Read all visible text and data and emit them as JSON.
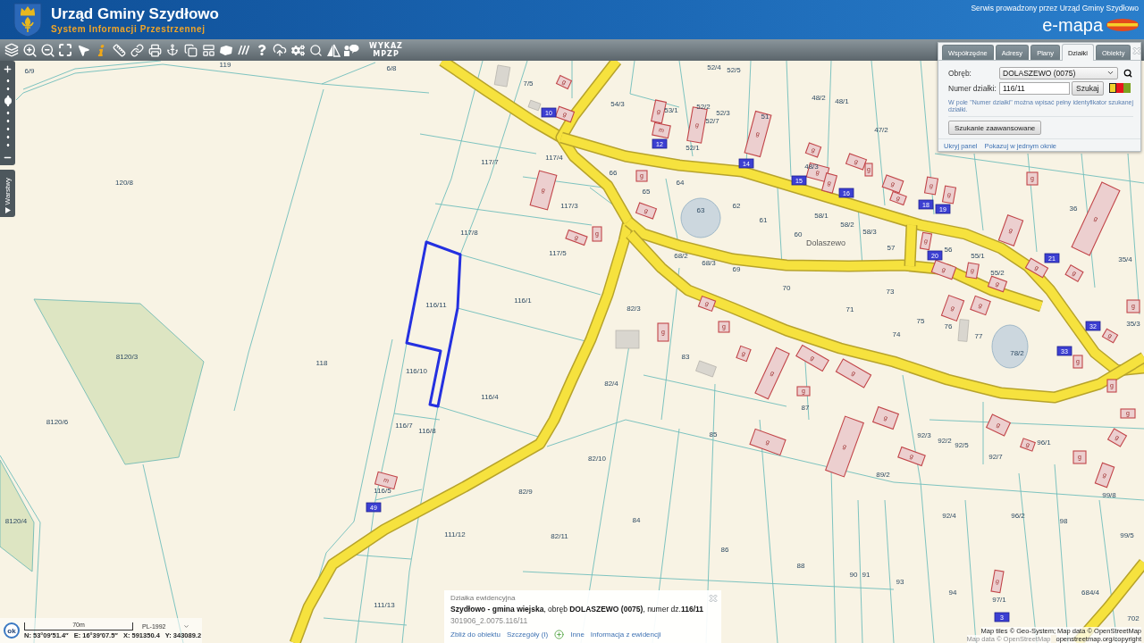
{
  "header": {
    "title": "Urząd Gminy Szydłowo",
    "subtitle": "System Informacji Przestrzennej",
    "service_note": "Serwis prowadzony przez Urząd Gminy Szydłowo",
    "brand": "e-mapa"
  },
  "toolbar": {
    "list_button": "WYKAZ MPZP"
  },
  "zoom_slider": {
    "level": 0.67
  },
  "layers_tab": {
    "label": "Warstwy"
  },
  "search_panel": {
    "tabs": [
      {
        "label": "Współrzędne",
        "selected": false
      },
      {
        "label": "Adresy",
        "selected": false
      },
      {
        "label": "Plany",
        "selected": false
      },
      {
        "label": "Działki",
        "selected": true
      },
      {
        "label": "Obiekty",
        "selected": false
      }
    ],
    "fields": [
      {
        "kind": "select",
        "label": "Obręb:",
        "value": "DOLASZEWO (0075)"
      },
      {
        "kind": "input",
        "label": "Numer działki:",
        "value": "116/11"
      }
    ],
    "search_button": "Szukaj",
    "colors": [
      {
        "color": "#f2d22a",
        "selected": true
      },
      {
        "color": "#e8141c",
        "selected": false
      },
      {
        "color": "#7ca21f",
        "selected": false
      }
    ],
    "hint": "W pole \"Numer działki\" można wpisać pełny identyfikator szukanej działki.",
    "advanced_button": "Szukanie zaawansowane",
    "links": [
      "Ukryj panel",
      "Pokazuj w jednym oknie"
    ]
  },
  "map": {
    "place_name": "Dolaszewo",
    "parcels": [
      {
        "number": "6/9",
        "selected": false
      },
      {
        "number": "119",
        "selected": false
      },
      {
        "number": "6/8",
        "selected": false
      },
      {
        "number": "120/8",
        "selected": false
      },
      {
        "number": "8120/3",
        "selected": false
      },
      {
        "number": "118",
        "selected": false
      },
      {
        "number": "8120/6",
        "selected": false
      },
      {
        "number": "8120/4",
        "selected": false
      },
      {
        "number": "117/7",
        "selected": false
      },
      {
        "number": "117/8",
        "selected": false
      },
      {
        "number": "117/4",
        "selected": false
      },
      {
        "number": "117/3",
        "selected": false
      },
      {
        "number": "117/5",
        "selected": false
      },
      {
        "number": "116/11",
        "selected": true
      },
      {
        "number": "116/1",
        "selected": false
      },
      {
        "number": "116/10",
        "selected": false
      },
      {
        "number": "116/4",
        "selected": false
      },
      {
        "number": "116/7",
        "selected": false
      },
      {
        "number": "116/8",
        "selected": false
      },
      {
        "number": "116/5",
        "selected": false
      },
      {
        "number": "111/12",
        "selected": false
      },
      {
        "number": "111/13",
        "selected": false
      },
      {
        "number": "7/5",
        "selected": false
      },
      {
        "number": "54/3",
        "selected": false
      },
      {
        "number": "53/1",
        "selected": false
      },
      {
        "number": "52/4",
        "selected": false
      },
      {
        "number": "52/5",
        "selected": false
      },
      {
        "number": "52/2",
        "selected": false
      },
      {
        "number": "52/3",
        "selected": false
      },
      {
        "number": "52/7",
        "selected": false
      },
      {
        "number": "52/1",
        "selected": false
      },
      {
        "number": "51",
        "selected": false
      },
      {
        "number": "48/2",
        "selected": false
      },
      {
        "number": "48/1",
        "selected": false
      },
      {
        "number": "47/2",
        "selected": false
      },
      {
        "number": "48/3",
        "selected": false
      },
      {
        "number": "66",
        "selected": false
      },
      {
        "number": "65",
        "selected": false
      },
      {
        "number": "64",
        "selected": false
      },
      {
        "number": "63",
        "selected": false
      },
      {
        "number": "62",
        "selected": false
      },
      {
        "number": "61",
        "selected": false
      },
      {
        "number": "58/1",
        "selected": false
      },
      {
        "number": "58/2",
        "selected": false
      },
      {
        "number": "58/3",
        "selected": false
      },
      {
        "number": "68/2",
        "selected": false
      },
      {
        "number": "68/3",
        "selected": false
      },
      {
        "number": "69",
        "selected": false
      },
      {
        "number": "70",
        "selected": false
      },
      {
        "number": "71",
        "selected": false
      },
      {
        "number": "73",
        "selected": false
      },
      {
        "number": "75",
        "selected": false
      },
      {
        "number": "74",
        "selected": false
      },
      {
        "number": "76",
        "selected": false
      },
      {
        "number": "77",
        "selected": false
      },
      {
        "number": "78/2",
        "selected": false
      },
      {
        "number": "36",
        "selected": false
      },
      {
        "number": "35/4",
        "selected": false
      },
      {
        "number": "35/3",
        "selected": false
      },
      {
        "number": "55/1",
        "selected": false
      },
      {
        "number": "55/2",
        "selected": false
      },
      {
        "number": "82/3",
        "selected": false
      },
      {
        "number": "82/4",
        "selected": false
      },
      {
        "number": "83",
        "selected": false
      },
      {
        "number": "85",
        "selected": false
      },
      {
        "number": "87",
        "selected": false
      },
      {
        "number": "82/10",
        "selected": false
      },
      {
        "number": "82/9",
        "selected": false
      },
      {
        "number": "84",
        "selected": false
      },
      {
        "number": "82/11",
        "selected": false
      },
      {
        "number": "86",
        "selected": false
      },
      {
        "number": "88",
        "selected": false
      },
      {
        "number": "90",
        "selected": false
      },
      {
        "number": "91",
        "selected": false
      },
      {
        "number": "93",
        "selected": false
      },
      {
        "number": "94",
        "selected": false
      },
      {
        "number": "89/2",
        "selected": false
      },
      {
        "number": "92/3",
        "selected": false
      },
      {
        "number": "92/2",
        "selected": false
      },
      {
        "number": "92/5",
        "selected": false
      },
      {
        "number": "92/7",
        "selected": false
      },
      {
        "number": "92/4",
        "selected": false
      },
      {
        "number": "96/2",
        "selected": false
      },
      {
        "number": "96/1",
        "selected": false
      },
      {
        "number": "98",
        "selected": false
      },
      {
        "number": "99/8",
        "selected": false
      },
      {
        "number": "99/5",
        "selected": false
      },
      {
        "number": "684/4",
        "selected": false
      },
      {
        "number": "97/1",
        "selected": false
      },
      {
        "number": "702",
        "selected": false
      },
      {
        "number": "60",
        "selected": false
      },
      {
        "number": "56",
        "selected": false
      },
      {
        "number": "57",
        "selected": false
      }
    ],
    "buildings": [
      {
        "label": "g"
      },
      {
        "label": "g"
      },
      {
        "label": "g"
      },
      {
        "label": "g"
      },
      {
        "label": "m"
      },
      {
        "label": "g"
      },
      {
        "label": "g"
      },
      {
        "label": "g"
      },
      {
        "label": "g"
      },
      {
        "label": "g"
      },
      {
        "label": "g"
      },
      {
        "label": "g"
      },
      {
        "label": "g"
      },
      {
        "label": "g"
      },
      {
        "label": "g"
      },
      {
        "label": "g"
      },
      {
        "label": "g"
      },
      {
        "label": "g"
      },
      {
        "label": "g"
      },
      {
        "label": "g"
      },
      {
        "label": "g"
      },
      {
        "label": "g"
      },
      {
        "label": "g"
      },
      {
        "label": "g"
      },
      {
        "label": "g"
      },
      {
        "label": "g"
      },
      {
        "label": "g"
      },
      {
        "label": "g"
      },
      {
        "label": "g"
      },
      {
        "label": "g"
      },
      {
        "label": "g"
      },
      {
        "label": "g"
      },
      {
        "label": "g"
      },
      {
        "label": "g"
      },
      {
        "label": "g"
      },
      {
        "label": "g"
      },
      {
        "label": "g"
      },
      {
        "label": "g"
      },
      {
        "label": "g"
      },
      {
        "label": "g"
      },
      {
        "label": "g"
      },
      {
        "label": "g"
      },
      {
        "label": "g"
      },
      {
        "label": "g"
      },
      {
        "label": "g"
      },
      {
        "label": "g"
      },
      {
        "label": "g"
      },
      {
        "label": "m"
      },
      {
        "label": "g"
      },
      {
        "label": "g"
      },
      {
        "label": "g"
      },
      {
        "label": "g"
      },
      {
        "label": "g"
      },
      {
        "label": "g"
      },
      {
        "label": "g"
      }
    ],
    "house_numbers": [
      {
        "number": "10"
      },
      {
        "number": "12"
      },
      {
        "number": "14"
      },
      {
        "number": "15"
      },
      {
        "number": "16"
      },
      {
        "number": "18"
      },
      {
        "number": "19"
      },
      {
        "number": "20"
      },
      {
        "number": "21"
      },
      {
        "number": "32"
      },
      {
        "number": "33"
      },
      {
        "number": "49"
      },
      {
        "number": "3"
      }
    ]
  },
  "info_popup": {
    "title": "Działka ewidencyjna",
    "description": "**Szydłowo - gmina wiejska**, obręb **DOLASZEWO (0075)**, numer dz.**116/11**",
    "identifier": "301906_2.0075.116/11",
    "links": [
      {
        "kind": "link",
        "label": "Zbliż do obiektu"
      },
      {
        "kind": "link",
        "label": "Szczegóły (I)"
      },
      {
        "kind": "more",
        "label": "Inne"
      },
      {
        "kind": "link",
        "label": "Informacja z ewidencji"
      }
    ]
  },
  "status_bar": {
    "ok_label": "ok",
    "scale_label": "70m",
    "crs": "PL-1992",
    "coordinates": [
      "N: 53°09′51.4″",
      "E: 16°39′07.5″",
      "X: 591350.4",
      "Y: 343089.2"
    ]
  },
  "attribution": {
    "tiles": "Map tiles © Geo-System; Map data © OpenStreetMap",
    "faded": "Map data © OpenStreetMap",
    "link": "openstreetmap.org/copyright"
  }
}
